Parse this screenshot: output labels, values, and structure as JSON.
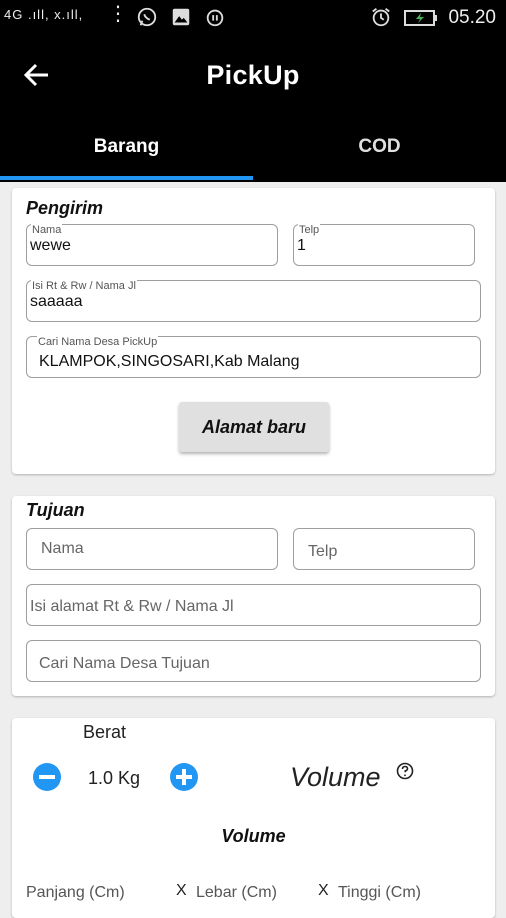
{
  "status_bar": {
    "left_signal_text": "4G .ıll, x.ıll,",
    "time": "05.20",
    "icons": [
      "more-vert-icon",
      "whatsapp-icon",
      "image-icon",
      "alarm-icon",
      "alarm-clock-icon",
      "battery-icon"
    ]
  },
  "app_bar": {
    "title": "PickUp",
    "back_icon": "arrow-left-icon"
  },
  "tabs": [
    {
      "label": "Barang",
      "selected": true
    },
    {
      "label": "COD",
      "selected": false
    }
  ],
  "colors": {
    "accent": "#2196f3",
    "app_bar": "#000000",
    "background": "#eeeeee"
  },
  "pengirim": {
    "title": "Pengirim",
    "nama": {
      "label": "Nama",
      "value": "wewe"
    },
    "telp": {
      "label": "Telp",
      "value": "1"
    },
    "alamat": {
      "label": "Isi Rt & Rw / Nama Jl",
      "value": "saaaaa"
    },
    "desa": {
      "label": "Cari Nama Desa PickUp",
      "value": "KLAMPOK,SINGOSARI,Kab Malang"
    },
    "button_label": "Alamat baru"
  },
  "tujuan": {
    "title": "Tujuan",
    "nama_placeholder": "Nama",
    "telp_placeholder": "Telp",
    "alamat_placeholder": "Isi alamat Rt & Rw / Nama Jl",
    "desa_placeholder": "Cari Nama Desa Tujuan"
  },
  "berat": {
    "label": "Berat",
    "value": "1.0 Kg",
    "minus_icon": "minus-circle-icon",
    "plus_icon": "plus-circle-icon",
    "volume_label": "Volume",
    "help_icon": "help-circle-icon"
  },
  "volume": {
    "title": "Volume",
    "panjang": "Panjang (Cm)",
    "lebar": "Lebar (Cm)",
    "tinggi": "Tinggi (Cm)",
    "separator": "X"
  }
}
